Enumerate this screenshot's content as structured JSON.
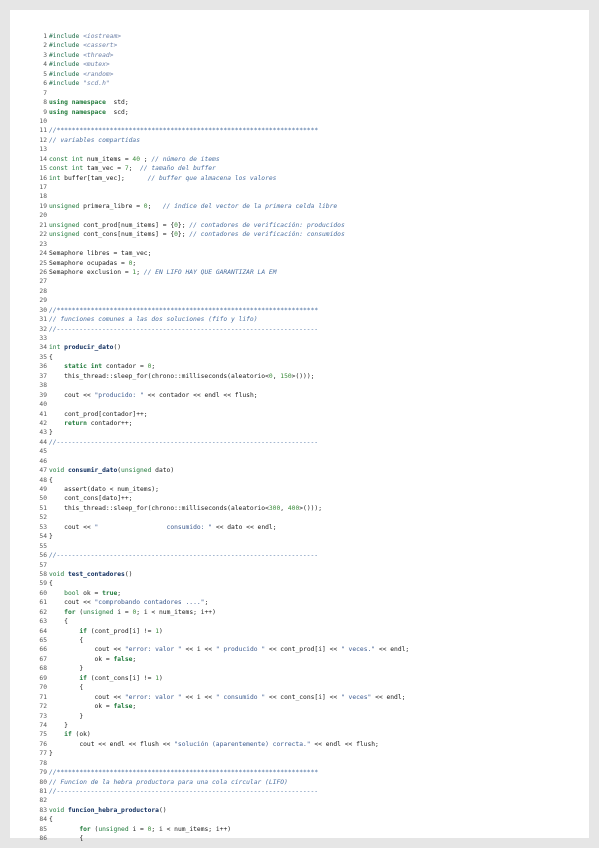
{
  "lines": [
    [
      [
        "pp",
        "#include "
      ],
      [
        "hd",
        "<iostream>"
      ]
    ],
    [
      [
        "pp",
        "#include "
      ],
      [
        "hd",
        "<cassert>"
      ]
    ],
    [
      [
        "pp",
        "#include "
      ],
      [
        "hd",
        "<thread>"
      ]
    ],
    [
      [
        "pp",
        "#include "
      ],
      [
        "hd",
        "<mutex>"
      ]
    ],
    [
      [
        "pp",
        "#include "
      ],
      [
        "hd",
        "<random>"
      ]
    ],
    [
      [
        "pp",
        "#include "
      ],
      [
        "hd",
        "\"scd.h\""
      ]
    ],
    [],
    [
      [
        "kw",
        "using namespace"
      ],
      [
        "",
        "  std;"
      ]
    ],
    [
      [
        "kw",
        "using namespace"
      ],
      [
        "",
        "  scd;"
      ]
    ],
    [],
    [
      [
        "cm",
        "//*********************************************************************"
      ]
    ],
    [
      [
        "cm",
        "// variables compartidas"
      ]
    ],
    [],
    [
      [
        "ty",
        "const int"
      ],
      [
        "",
        " num_items = "
      ],
      [
        "num",
        "40"
      ],
      [
        "",
        " ; "
      ],
      [
        "cm",
        "// número de items"
      ]
    ],
    [
      [
        "ty",
        "const int"
      ],
      [
        "",
        " tam_vec = "
      ],
      [
        "num",
        "7"
      ],
      [
        "",
        ";  "
      ],
      [
        "cm",
        "// tamaño del buffer"
      ]
    ],
    [
      [
        "ty",
        "int"
      ],
      [
        "",
        " buffer[tam_vec];      "
      ],
      [
        "cm",
        "// buffer que almacena los valores"
      ]
    ],
    [],
    [],
    [
      [
        "ty",
        "unsigned"
      ],
      [
        "",
        " primera_libre = "
      ],
      [
        "num",
        "0"
      ],
      [
        "",
        ";   "
      ],
      [
        "cm",
        "// índice del vector de la primera celda libre"
      ]
    ],
    [],
    [
      [
        "ty",
        "unsigned"
      ],
      [
        "",
        " cont_prod[num_items] = {"
      ],
      [
        "num",
        "0"
      ],
      [
        "",
        "}; "
      ],
      [
        "cm",
        "// contadores de verificación: producidos"
      ]
    ],
    [
      [
        "ty",
        "unsigned"
      ],
      [
        "",
        " cont_cons[num_items] = {"
      ],
      [
        "num",
        "0"
      ],
      [
        "",
        "}; "
      ],
      [
        "cm",
        "// contadores de verificación: consumidos"
      ]
    ],
    [],
    [
      [
        "",
        "Semaphore libres = tam_vec;"
      ]
    ],
    [
      [
        "",
        "Semaphore ocupadas = "
      ],
      [
        "num",
        "0"
      ],
      [
        "",
        ";"
      ]
    ],
    [
      [
        "",
        "Semaphore exclusion = "
      ],
      [
        "num",
        "1"
      ],
      [
        "",
        "; "
      ],
      [
        "cm",
        "// EN LIFO HAY QUE GARANTIZAR LA EM"
      ]
    ],
    [],
    [],
    [],
    [
      [
        "cm",
        "//*********************************************************************"
      ]
    ],
    [
      [
        "cm",
        "// funciones comunes a las dos soluciones (fifo y lifo)"
      ]
    ],
    [
      [
        "cm",
        "//---------------------------------------------------------------------"
      ]
    ],
    [],
    [
      [
        "ty",
        "int"
      ],
      [
        "fn",
        " producir_dato"
      ],
      [
        "",
        "()"
      ]
    ],
    [
      [
        "",
        "{"
      ]
    ],
    [
      [
        "",
        "    "
      ],
      [
        "kw",
        "static int"
      ],
      [
        "",
        " contador = "
      ],
      [
        "num",
        "0"
      ],
      [
        "",
        ";"
      ]
    ],
    [
      [
        "",
        "    this_thread::sleep_for(chrono::milliseconds(aleatorio<"
      ],
      [
        "num",
        "0"
      ],
      [
        "",
        ", "
      ],
      [
        "num",
        "150"
      ],
      [
        "",
        ">()));"
      ]
    ],
    [],
    [
      [
        "",
        "    cout << "
      ],
      [
        "str",
        "\"producido: \""
      ],
      [
        "",
        " << contador << endl << flush;"
      ]
    ],
    [],
    [
      [
        "",
        "    cont_prod[contador]++;"
      ]
    ],
    [
      [
        "",
        "    "
      ],
      [
        "kw",
        "return"
      ],
      [
        "",
        " contador++;"
      ]
    ],
    [
      [
        "",
        "}"
      ]
    ],
    [
      [
        "cm",
        "//---------------------------------------------------------------------"
      ]
    ],
    [],
    [],
    [
      [
        "ty",
        "void"
      ],
      [
        "fn",
        " consumir_dato"
      ],
      [
        "",
        "("
      ],
      [
        "ty",
        "unsigned"
      ],
      [
        "",
        " dato)"
      ]
    ],
    [
      [
        "",
        "{"
      ]
    ],
    [
      [
        "",
        "    assert(dato < num_items);"
      ]
    ],
    [
      [
        "",
        "    cont_cons[dato]++;"
      ]
    ],
    [
      [
        "",
        "    this_thread::sleep_for(chrono::milliseconds(aleatorio<"
      ],
      [
        "num",
        "300"
      ],
      [
        "",
        ", "
      ],
      [
        "num",
        "400"
      ],
      [
        "",
        ">()));"
      ]
    ],
    [],
    [
      [
        "",
        "    cout << "
      ],
      [
        "str",
        "\"                  consumido: \""
      ],
      [
        "",
        " << dato << endl;"
      ]
    ],
    [
      [
        "",
        "}"
      ]
    ],
    [],
    [
      [
        "cm",
        "//---------------------------------------------------------------------"
      ]
    ],
    [],
    [
      [
        "ty",
        "void"
      ],
      [
        "fn",
        " test_contadores"
      ],
      [
        "",
        "()"
      ]
    ],
    [
      [
        "",
        "{"
      ]
    ],
    [
      [
        "",
        "    "
      ],
      [
        "ty",
        "bool"
      ],
      [
        "",
        " ok = "
      ],
      [
        "kw",
        "true"
      ],
      [
        "",
        ";"
      ]
    ],
    [
      [
        "",
        "    cout << "
      ],
      [
        "str",
        "\"comprobando contadores ....\""
      ],
      [
        "",
        ";"
      ]
    ],
    [
      [
        "",
        "    "
      ],
      [
        "kw",
        "for"
      ],
      [
        "",
        " ("
      ],
      [
        "ty",
        "unsigned"
      ],
      [
        "",
        " i = "
      ],
      [
        "num",
        "0"
      ],
      [
        "",
        "; i < num_items; i++)"
      ]
    ],
    [
      [
        "",
        "    {"
      ]
    ],
    [
      [
        "",
        "        "
      ],
      [
        "kw",
        "if"
      ],
      [
        "",
        " (cont_prod[i] != "
      ],
      [
        "num",
        "1"
      ],
      [
        "",
        ")"
      ]
    ],
    [
      [
        "",
        "        {"
      ]
    ],
    [
      [
        "",
        "            cout << "
      ],
      [
        "str",
        "\"error: valor \""
      ],
      [
        "",
        " << i << "
      ],
      [
        "str",
        "\" producido \""
      ],
      [
        "",
        " << cont_prod[i] << "
      ],
      [
        "str",
        "\" veces.\""
      ],
      [
        "",
        " << endl;"
      ]
    ],
    [
      [
        "",
        "            ok = "
      ],
      [
        "kw",
        "false"
      ],
      [
        "",
        ";"
      ]
    ],
    [
      [
        "",
        "        }"
      ]
    ],
    [
      [
        "",
        "        "
      ],
      [
        "kw",
        "if"
      ],
      [
        "",
        " (cont_cons[i] != "
      ],
      [
        "num",
        "1"
      ],
      [
        "",
        ")"
      ]
    ],
    [
      [
        "",
        "        {"
      ]
    ],
    [
      [
        "",
        "            cout << "
      ],
      [
        "str",
        "\"error: valor \""
      ],
      [
        "",
        " << i << "
      ],
      [
        "str",
        "\" consumido \""
      ],
      [
        "",
        " << cont_cons[i] << "
      ],
      [
        "str",
        "\" veces\""
      ],
      [
        "",
        " << endl;"
      ]
    ],
    [
      [
        "",
        "            ok = "
      ],
      [
        "kw",
        "false"
      ],
      [
        "",
        ";"
      ]
    ],
    [
      [
        "",
        "        }"
      ]
    ],
    [
      [
        "",
        "    }"
      ]
    ],
    [
      [
        "",
        "    "
      ],
      [
        "kw",
        "if"
      ],
      [
        "",
        " (ok)"
      ]
    ],
    [
      [
        "",
        "        cout << endl << flush << "
      ],
      [
        "str",
        "\"solución (aparentemente) correcta.\""
      ],
      [
        "",
        " << endl << flush;"
      ]
    ],
    [
      [
        "",
        "}"
      ]
    ],
    [],
    [
      [
        "cm",
        "//*********************************************************************"
      ]
    ],
    [
      [
        "cm",
        "// Funcion de la hebra productora para una cola circular (LIFO)"
      ]
    ],
    [
      [
        "cm",
        "//---------------------------------------------------------------------"
      ]
    ],
    [],
    [
      [
        "ty",
        "void"
      ],
      [
        "fn",
        " funcion_hebra_productora"
      ],
      [
        "",
        "()"
      ]
    ],
    [
      [
        "",
        "{"
      ]
    ],
    [
      [
        "",
        "        "
      ],
      [
        "kw",
        "for"
      ],
      [
        "",
        " ("
      ],
      [
        "ty",
        "unsigned"
      ],
      [
        "",
        " i = "
      ],
      [
        "num",
        "0"
      ],
      [
        "",
        "; i < num_items; i++)"
      ]
    ],
    [
      [
        "",
        "        {"
      ]
    ]
  ]
}
